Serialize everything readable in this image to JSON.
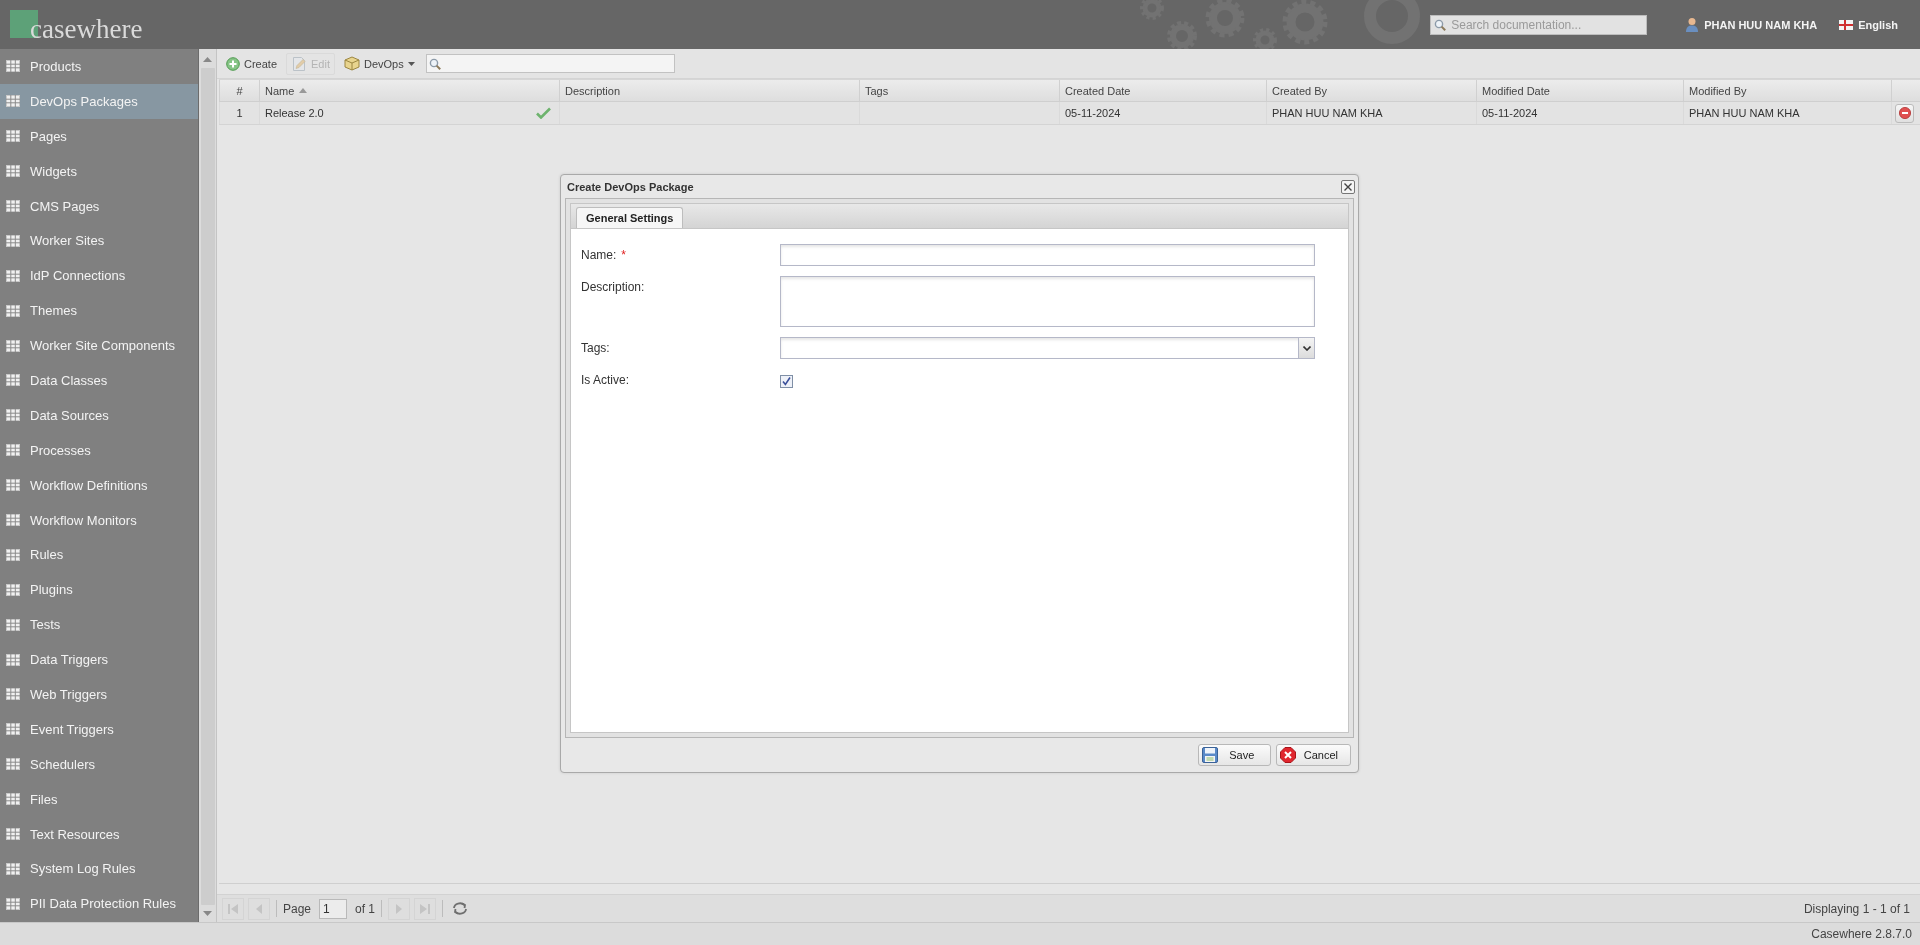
{
  "header": {
    "logo": "casewhere",
    "search": {
      "placeholder": "Search documentation..."
    },
    "user": "PHAN HUU NAM KHA",
    "language": "English"
  },
  "sidebar": {
    "items": [
      {
        "label": "Products",
        "selected": false
      },
      {
        "label": "DevOps Packages",
        "selected": true
      },
      {
        "label": "Pages",
        "selected": false
      },
      {
        "label": "Widgets",
        "selected": false
      },
      {
        "label": "CMS Pages",
        "selected": false
      },
      {
        "label": "Worker Sites",
        "selected": false
      },
      {
        "label": "IdP Connections",
        "selected": false
      },
      {
        "label": "Themes",
        "selected": false
      },
      {
        "label": "Worker Site Components",
        "selected": false
      },
      {
        "label": "Data Classes",
        "selected": false
      },
      {
        "label": "Data Sources",
        "selected": false
      },
      {
        "label": "Processes",
        "selected": false
      },
      {
        "label": "Workflow Definitions",
        "selected": false
      },
      {
        "label": "Workflow Monitors",
        "selected": false
      },
      {
        "label": "Rules",
        "selected": false
      },
      {
        "label": "Plugins",
        "selected": false
      },
      {
        "label": "Tests",
        "selected": false
      },
      {
        "label": "Data Triggers",
        "selected": false
      },
      {
        "label": "Web Triggers",
        "selected": false
      },
      {
        "label": "Event Triggers",
        "selected": false
      },
      {
        "label": "Schedulers",
        "selected": false
      },
      {
        "label": "Files",
        "selected": false
      },
      {
        "label": "Text Resources",
        "selected": false
      },
      {
        "label": "System Log Rules",
        "selected": false
      },
      {
        "label": "PII Data Protection Rules",
        "selected": false
      }
    ]
  },
  "toolbar": {
    "buttons": [
      {
        "kind": "create",
        "label": "Create",
        "disabled": false
      },
      {
        "kind": "edit",
        "label": "Edit",
        "disabled": true
      },
      {
        "kind": "menu",
        "label": "DevOps",
        "disabled": false
      }
    ]
  },
  "grid": {
    "columns": [
      {
        "label": "#",
        "sorted": false
      },
      {
        "label": "Name",
        "sorted": true
      },
      {
        "label": "Description",
        "sorted": false
      },
      {
        "label": "Tags",
        "sorted": false
      },
      {
        "label": "Created Date",
        "sorted": false
      },
      {
        "label": "Created By",
        "sorted": false
      },
      {
        "label": "Modified Date",
        "sorted": false
      },
      {
        "label": "Modified By",
        "sorted": false
      }
    ],
    "rows": [
      {
        "number": "1",
        "name": "Release 2.0",
        "active": true,
        "created_date": "05-11-2024",
        "created_by": "PHAN HUU NAM KHA",
        "modified_date": "05-11-2024",
        "modified_by": "PHAN HUU NAM KHA"
      }
    ]
  },
  "dialog": {
    "title": "Create DevOps Package",
    "tabs": [
      {
        "label": "General Settings",
        "selected": true
      }
    ],
    "fields": [
      {
        "kind": "text",
        "label": "Name:",
        "required_mark": "*"
      },
      {
        "kind": "textarea",
        "label": "Description:"
      },
      {
        "kind": "select",
        "label": "Tags:"
      },
      {
        "kind": "checkbox",
        "label": "Is Active:",
        "checked": true
      }
    ],
    "buttons": [
      {
        "kind": "save",
        "label": "Save"
      },
      {
        "kind": "cancel",
        "label": "Cancel"
      }
    ]
  },
  "paging": {
    "nav_start": [
      {
        "kind": "first",
        "disabled": true
      },
      {
        "kind": "prev",
        "disabled": true
      }
    ],
    "page_label": "Page",
    "page": "1",
    "page_count": "of 1",
    "nav_end": [
      {
        "kind": "next",
        "disabled": true
      },
      {
        "kind": "last",
        "disabled": true
      },
      {
        "kind": "refresh",
        "disabled": false
      }
    ],
    "display": "Displaying 1 - 1 of 1"
  },
  "status_bar": {
    "version": "Casewhere 2.8.7.0"
  }
}
